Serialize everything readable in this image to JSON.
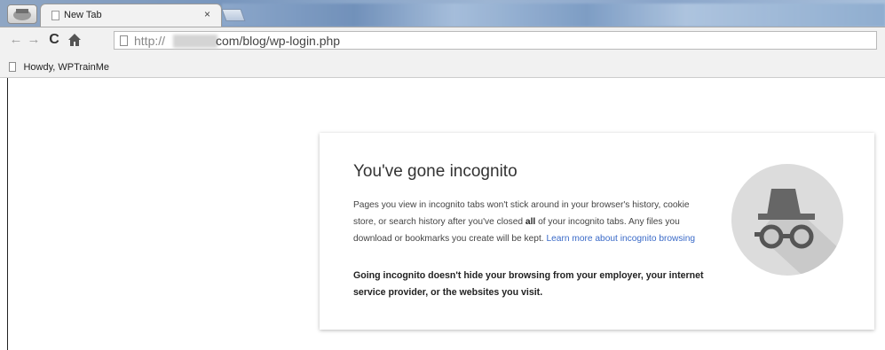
{
  "tab": {
    "title": "New Tab",
    "close_glyph": "×",
    "favicon": "page-icon"
  },
  "toolbar": {
    "back_glyph": "←",
    "forward_glyph": "→",
    "reload_glyph": "C",
    "home_glyph": "⌂"
  },
  "omnibox": {
    "scheme": "http://",
    "rest": "com/blog/wp-login.php"
  },
  "bookmarks": {
    "items": [
      {
        "label": "Howdy, WPTrainMe",
        "icon": "page-icon"
      }
    ]
  },
  "incognito": {
    "title": "You've gone incognito",
    "para_1": "Pages you view in incognito tabs won't stick around in your browser's history, cookie store, or search history after you've closed ",
    "para_bold": "all",
    "para_2": " of your incognito tabs. Any files you download or bookmarks you create will be kept. ",
    "learn_more": "Learn more about incognito browsing",
    "warning": "Going incognito doesn't hide your browsing from your employer, your internet service provider, or the websites you visit.",
    "icon": "incognito-spy-icon"
  },
  "colors": {
    "link": "#3a6ac8",
    "icon_circle": "#dcdcdc",
    "icon_figure": "#666666"
  }
}
